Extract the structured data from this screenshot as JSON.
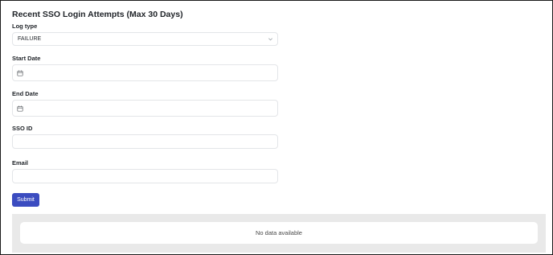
{
  "form": {
    "title": "Recent SSO Login Attempts (Max 30 Days)",
    "log_type": {
      "label": "Log type",
      "value": "FAILURE"
    },
    "start_date": {
      "label": "Start Date",
      "value": ""
    },
    "end_date": {
      "label": "End Date",
      "value": ""
    },
    "sso_id": {
      "label": "SSO ID",
      "value": ""
    },
    "email": {
      "label": "Email",
      "value": ""
    },
    "submit_label": "Submit"
  },
  "results": {
    "empty_message": "No data available"
  },
  "colors": {
    "primary_button": "#3b4cc0",
    "results_panel_bg": "#e9e9e9",
    "field_border": "#e3e5e8"
  },
  "icons": {
    "select_caret": "chevron-down-icon",
    "date_picker": "calendar-icon"
  }
}
